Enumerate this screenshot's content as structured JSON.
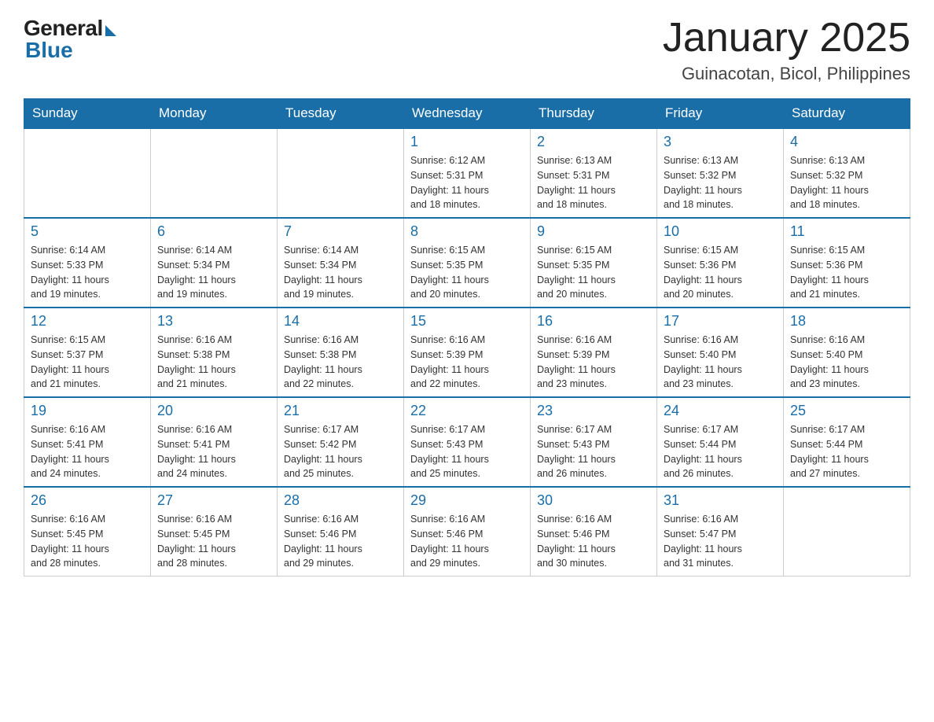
{
  "header": {
    "logo_general": "General",
    "logo_blue": "Blue",
    "main_title": "January 2025",
    "subtitle": "Guinacotan, Bicol, Philippines"
  },
  "calendar": {
    "days_of_week": [
      "Sunday",
      "Monday",
      "Tuesday",
      "Wednesday",
      "Thursday",
      "Friday",
      "Saturday"
    ],
    "weeks": [
      {
        "days": [
          {
            "number": "",
            "info": ""
          },
          {
            "number": "",
            "info": ""
          },
          {
            "number": "",
            "info": ""
          },
          {
            "number": "1",
            "info": "Sunrise: 6:12 AM\nSunset: 5:31 PM\nDaylight: 11 hours\nand 18 minutes."
          },
          {
            "number": "2",
            "info": "Sunrise: 6:13 AM\nSunset: 5:31 PM\nDaylight: 11 hours\nand 18 minutes."
          },
          {
            "number": "3",
            "info": "Sunrise: 6:13 AM\nSunset: 5:32 PM\nDaylight: 11 hours\nand 18 minutes."
          },
          {
            "number": "4",
            "info": "Sunrise: 6:13 AM\nSunset: 5:32 PM\nDaylight: 11 hours\nand 18 minutes."
          }
        ]
      },
      {
        "days": [
          {
            "number": "5",
            "info": "Sunrise: 6:14 AM\nSunset: 5:33 PM\nDaylight: 11 hours\nand 19 minutes."
          },
          {
            "number": "6",
            "info": "Sunrise: 6:14 AM\nSunset: 5:34 PM\nDaylight: 11 hours\nand 19 minutes."
          },
          {
            "number": "7",
            "info": "Sunrise: 6:14 AM\nSunset: 5:34 PM\nDaylight: 11 hours\nand 19 minutes."
          },
          {
            "number": "8",
            "info": "Sunrise: 6:15 AM\nSunset: 5:35 PM\nDaylight: 11 hours\nand 20 minutes."
          },
          {
            "number": "9",
            "info": "Sunrise: 6:15 AM\nSunset: 5:35 PM\nDaylight: 11 hours\nand 20 minutes."
          },
          {
            "number": "10",
            "info": "Sunrise: 6:15 AM\nSunset: 5:36 PM\nDaylight: 11 hours\nand 20 minutes."
          },
          {
            "number": "11",
            "info": "Sunrise: 6:15 AM\nSunset: 5:36 PM\nDaylight: 11 hours\nand 21 minutes."
          }
        ]
      },
      {
        "days": [
          {
            "number": "12",
            "info": "Sunrise: 6:15 AM\nSunset: 5:37 PM\nDaylight: 11 hours\nand 21 minutes."
          },
          {
            "number": "13",
            "info": "Sunrise: 6:16 AM\nSunset: 5:38 PM\nDaylight: 11 hours\nand 21 minutes."
          },
          {
            "number": "14",
            "info": "Sunrise: 6:16 AM\nSunset: 5:38 PM\nDaylight: 11 hours\nand 22 minutes."
          },
          {
            "number": "15",
            "info": "Sunrise: 6:16 AM\nSunset: 5:39 PM\nDaylight: 11 hours\nand 22 minutes."
          },
          {
            "number": "16",
            "info": "Sunrise: 6:16 AM\nSunset: 5:39 PM\nDaylight: 11 hours\nand 23 minutes."
          },
          {
            "number": "17",
            "info": "Sunrise: 6:16 AM\nSunset: 5:40 PM\nDaylight: 11 hours\nand 23 minutes."
          },
          {
            "number": "18",
            "info": "Sunrise: 6:16 AM\nSunset: 5:40 PM\nDaylight: 11 hours\nand 23 minutes."
          }
        ]
      },
      {
        "days": [
          {
            "number": "19",
            "info": "Sunrise: 6:16 AM\nSunset: 5:41 PM\nDaylight: 11 hours\nand 24 minutes."
          },
          {
            "number": "20",
            "info": "Sunrise: 6:16 AM\nSunset: 5:41 PM\nDaylight: 11 hours\nand 24 minutes."
          },
          {
            "number": "21",
            "info": "Sunrise: 6:17 AM\nSunset: 5:42 PM\nDaylight: 11 hours\nand 25 minutes."
          },
          {
            "number": "22",
            "info": "Sunrise: 6:17 AM\nSunset: 5:43 PM\nDaylight: 11 hours\nand 25 minutes."
          },
          {
            "number": "23",
            "info": "Sunrise: 6:17 AM\nSunset: 5:43 PM\nDaylight: 11 hours\nand 26 minutes."
          },
          {
            "number": "24",
            "info": "Sunrise: 6:17 AM\nSunset: 5:44 PM\nDaylight: 11 hours\nand 26 minutes."
          },
          {
            "number": "25",
            "info": "Sunrise: 6:17 AM\nSunset: 5:44 PM\nDaylight: 11 hours\nand 27 minutes."
          }
        ]
      },
      {
        "days": [
          {
            "number": "26",
            "info": "Sunrise: 6:16 AM\nSunset: 5:45 PM\nDaylight: 11 hours\nand 28 minutes."
          },
          {
            "number": "27",
            "info": "Sunrise: 6:16 AM\nSunset: 5:45 PM\nDaylight: 11 hours\nand 28 minutes."
          },
          {
            "number": "28",
            "info": "Sunrise: 6:16 AM\nSunset: 5:46 PM\nDaylight: 11 hours\nand 29 minutes."
          },
          {
            "number": "29",
            "info": "Sunrise: 6:16 AM\nSunset: 5:46 PM\nDaylight: 11 hours\nand 29 minutes."
          },
          {
            "number": "30",
            "info": "Sunrise: 6:16 AM\nSunset: 5:46 PM\nDaylight: 11 hours\nand 30 minutes."
          },
          {
            "number": "31",
            "info": "Sunrise: 6:16 AM\nSunset: 5:47 PM\nDaylight: 11 hours\nand 31 minutes."
          },
          {
            "number": "",
            "info": ""
          }
        ]
      }
    ]
  }
}
